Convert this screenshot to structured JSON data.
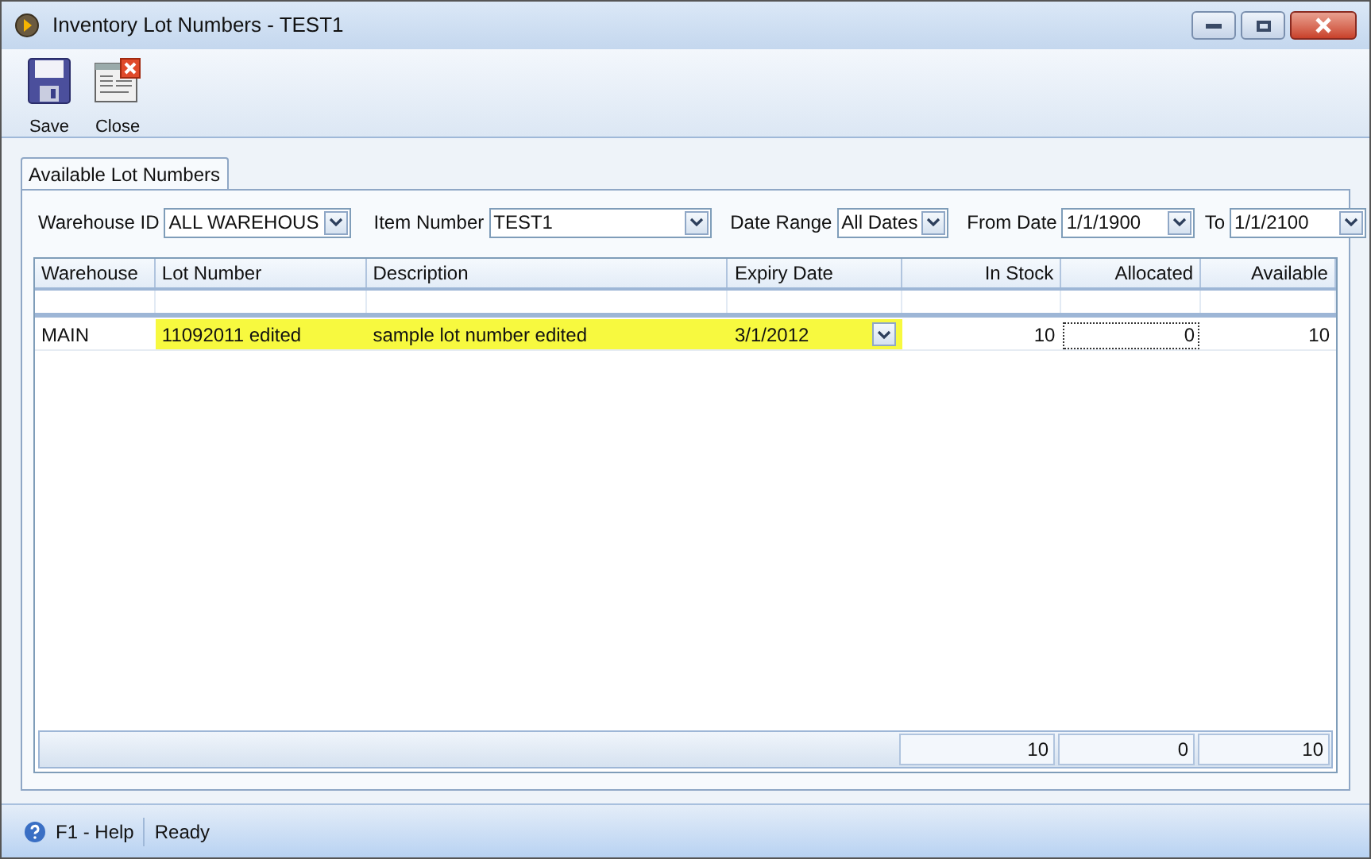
{
  "window": {
    "title": "Inventory Lot Numbers - TEST1"
  },
  "toolbar": [
    {
      "label": "Save",
      "kind": "save"
    },
    {
      "label": "Close",
      "kind": "close"
    }
  ],
  "tabs": [
    {
      "label": "Available Lot Numbers",
      "selected": true
    }
  ],
  "filters": [
    {
      "label": "Warehouse ID",
      "value": "ALL WAREHOUS"
    },
    {
      "label": "Item Number",
      "value": "TEST1"
    },
    {
      "label": "Date Range",
      "value": "All Dates"
    },
    {
      "label": "From Date",
      "value": "1/1/1900"
    },
    {
      "label": "To",
      "value": "1/1/2100"
    }
  ],
  "table": {
    "columns": [
      {
        "label": "Warehouse"
      },
      {
        "label": "Lot Number"
      },
      {
        "label": "Description"
      },
      {
        "label": "Expiry Date"
      },
      {
        "label": "In Stock"
      },
      {
        "label": "Allocated"
      },
      {
        "label": "Available"
      }
    ],
    "rows": [
      {
        "cells": [
          {
            "text": "MAIN",
            "edited": false,
            "kind": "text"
          },
          {
            "text": "11092011 edited",
            "edited": true,
            "kind": "text"
          },
          {
            "text": "sample lot number edited",
            "edited": true,
            "kind": "text"
          },
          {
            "text": "3/1/2012",
            "edited": true,
            "kind": "date"
          },
          {
            "text": "10",
            "edited": false,
            "kind": "text"
          },
          {
            "text": "0",
            "edited": false,
            "kind": "editing"
          },
          {
            "text": "10",
            "edited": false,
            "kind": "text"
          }
        ]
      }
    ],
    "totals": [
      "10",
      "0",
      "10"
    ]
  },
  "status_bar": {
    "help": "F1 - Help",
    "status": "Ready"
  }
}
